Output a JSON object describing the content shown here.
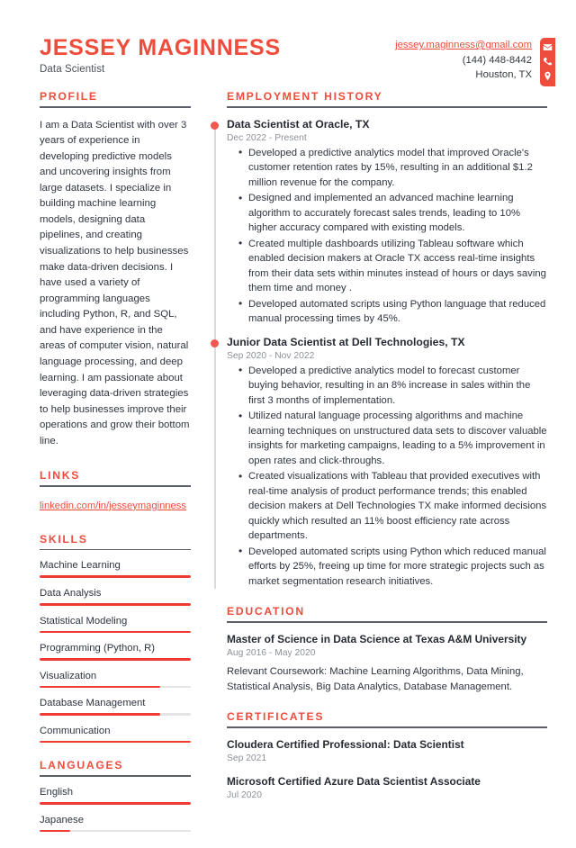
{
  "header": {
    "name": "JESSEY MAGINNESS",
    "title": "Data Scientist",
    "contact": {
      "email": "jessey.maginness@gmail.com",
      "phone": "(144) 448-8442",
      "location": "Houston, TX",
      "icons": [
        "envelope-icon",
        "phone-icon",
        "map-pin-icon"
      ]
    }
  },
  "theme": {
    "accent": "#ee4c3c",
    "bar_fill": "#ef3b34",
    "bar_track": "#e4e4e4",
    "rule": "#5b6068",
    "muted_text": "#8d9199"
  },
  "left": {
    "profile": {
      "heading": "PROFILE",
      "text": "I am a Data Scientist with over 3 years of experience in developing predictive models and uncovering insights from large datasets. I specialize in building machine learning models, designing data pipelines, and creating visualizations to help businesses make data-driven decisions. I have used a variety of programming languages including Python, R, and SQL, and have experience in the areas of computer vision, natural language processing, and deep learning. I am passionate about leveraging data-driven strategies to help businesses improve their operations and grow their bottom line."
    },
    "links": {
      "heading": "LINKS",
      "items": [
        {
          "label": "linkedin.com/in/jesseymaginness"
        }
      ]
    },
    "skills": {
      "heading": "SKILLS",
      "items": [
        {
          "label": "Machine Learning",
          "level": 100
        },
        {
          "label": "Data Analysis",
          "level": 100
        },
        {
          "label": "Statistical Modeling",
          "level": 100
        },
        {
          "label": "Programming (Python, R)",
          "level": 100
        },
        {
          "label": "Visualization",
          "level": 80
        },
        {
          "label": "Database Management",
          "level": 80
        },
        {
          "label": "Communication",
          "level": 100
        }
      ]
    },
    "languages": {
      "heading": "LANGUAGES",
      "items": [
        {
          "label": "English",
          "level": 100
        },
        {
          "label": "Japanese",
          "level": 20
        }
      ]
    }
  },
  "right": {
    "employment": {
      "heading": "EMPLOYMENT HISTORY",
      "jobs": [
        {
          "role": "Data Scientist at Oracle, TX",
          "dates": "Dec 2022 - Present",
          "bullets": [
            "Developed a predictive analytics model that improved Oracle's customer retention rates by 15%, resulting in an additional $1.2 million revenue for the company.",
            "Designed and implemented an advanced machine learning algorithm to accurately forecast sales trends, leading to 10% higher accuracy compared with existing models.",
            "Created multiple dashboards utilizing Tableau software which enabled decision makers at Oracle TX access real-time insights from their data sets within minutes instead of hours or days saving them time and money .",
            "Developed automated scripts using Python language that reduced manual processing times by 45%."
          ]
        },
        {
          "role": "Junior Data Scientist at Dell Technologies, TX",
          "dates": "Sep 2020 - Nov 2022",
          "bullets": [
            "Developed a predictive analytics model to forecast customer buying behavior, resulting in an 8% increase in sales within the first 3 months of implementation.",
            "Utilized natural language processing algorithms and machine learning techniques on unstructured data sets to discover valuable insights for marketing campaigns, leading to a 5% improvement in open rates and click-throughs.",
            "Created visualizations with Tableau that provided executives with real-time analysis of product performance trends; this enabled decision makers at Dell Technologies TX make informed decisions quickly which resulted an 11% boost efficiency rate across departments.",
            "Developed automated scripts using Python which reduced manual efforts by 25%, freeing up time for more strategic projects such as market segmentation research initiatives."
          ]
        }
      ]
    },
    "education": {
      "heading": "EDUCATION",
      "entries": [
        {
          "title": "Master of Science in Data Science at Texas A&M University",
          "dates": "Aug 2016 - May 2020",
          "desc": "Relevant Coursework: Machine Learning Algorithms, Data Mining, Statistical Analysis, Big Data Analytics, Database Management."
        }
      ]
    },
    "certificates": {
      "heading": "CERTIFICATES",
      "entries": [
        {
          "title": "Cloudera Certified Professional: Data Scientist",
          "dates": "Sep 2021"
        },
        {
          "title": "Microsoft Certified Azure Data Scientist Associate",
          "dates": "Jul 2020"
        }
      ]
    }
  }
}
